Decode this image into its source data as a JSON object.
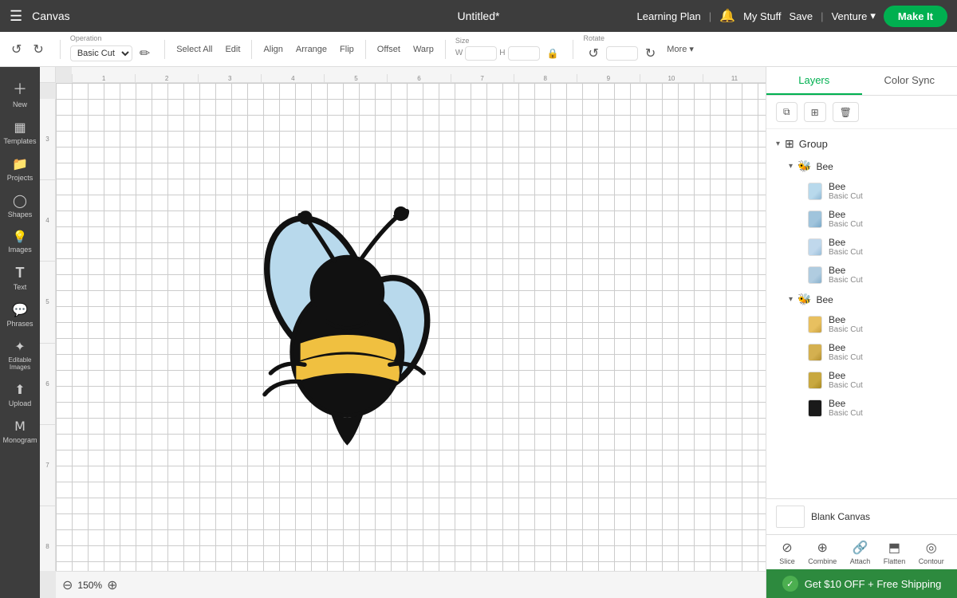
{
  "topbar": {
    "menu_label": "☰",
    "canvas_label": "Canvas",
    "title": "Untitled*",
    "learning_plan": "Learning Plan",
    "bell": "🔔",
    "my_stuff": "My Stuff",
    "save": "Save",
    "divider1": "|",
    "divider2": "|",
    "venture": "Venture",
    "make_it": "Make It"
  },
  "toolbar": {
    "operation_label": "Operation",
    "operation_value": "Basic Cut",
    "select_all": "Select All",
    "edit": "Edit",
    "align": "Align",
    "arrange": "Arrange",
    "flip": "Flip",
    "offset": "Offset",
    "warp": "Warp",
    "size": "Size",
    "rotate": "Rotate",
    "more": "More ▾",
    "undo": "↺",
    "redo": "↻"
  },
  "sidebar": {
    "items": [
      {
        "label": "New",
        "icon": "＋"
      },
      {
        "label": "Templates",
        "icon": "▦"
      },
      {
        "label": "Projects",
        "icon": "📁"
      },
      {
        "label": "Shapes",
        "icon": "◯"
      },
      {
        "label": "Images",
        "icon": "💡"
      },
      {
        "label": "Text",
        "icon": "T"
      },
      {
        "label": "Phrases",
        "icon": "💬"
      },
      {
        "label": "Editable Images",
        "icon": "✦"
      },
      {
        "label": "Upload",
        "icon": "⬆"
      },
      {
        "label": "Monogram",
        "icon": "M"
      }
    ]
  },
  "panel": {
    "tabs": [
      {
        "label": "Layers",
        "active": true
      },
      {
        "label": "Color Sync",
        "active": false
      }
    ],
    "group_label": "Group",
    "subgroups": [
      {
        "label": "Bee",
        "items": [
          {
            "name": "Bee",
            "type": "Basic Cut",
            "color": "#b8d4e8"
          },
          {
            "name": "Bee",
            "type": "Basic Cut",
            "color": "#a0c4dc"
          },
          {
            "name": "Bee",
            "type": "Basic Cut",
            "color": "#c0d8ec"
          },
          {
            "name": "Bee",
            "type": "Basic Cut",
            "color": "#b0cce0"
          }
        ]
      },
      {
        "label": "Bee",
        "items": [
          {
            "name": "Bee",
            "type": "Basic Cut",
            "color": "#e8c060"
          },
          {
            "name": "Bee",
            "type": "Basic Cut",
            "color": "#d4b050"
          },
          {
            "name": "Bee",
            "type": "Basic Cut",
            "color": "#c8a840"
          },
          {
            "name": "Bee",
            "type": "Basic Cut",
            "color": "#1a1a1a"
          }
        ]
      }
    ],
    "blank_canvas": "Blank Canvas"
  },
  "panel_bottom": {
    "buttons": [
      {
        "label": "Slice",
        "icon": "⊘"
      },
      {
        "label": "Combine",
        "icon": "⊕"
      },
      {
        "label": "Attach",
        "icon": "🔗"
      },
      {
        "label": "Flatten",
        "icon": "⬒"
      },
      {
        "label": "Contour",
        "icon": "◎"
      }
    ]
  },
  "promo": {
    "badge": "✓",
    "text": "Get $10 OFF + Free Shipping"
  },
  "zoom": {
    "level": "150%"
  },
  "ruler": {
    "ticks": [
      "1",
      "2",
      "3",
      "4",
      "5",
      "6",
      "7",
      "8",
      "9",
      "10",
      "11"
    ]
  }
}
